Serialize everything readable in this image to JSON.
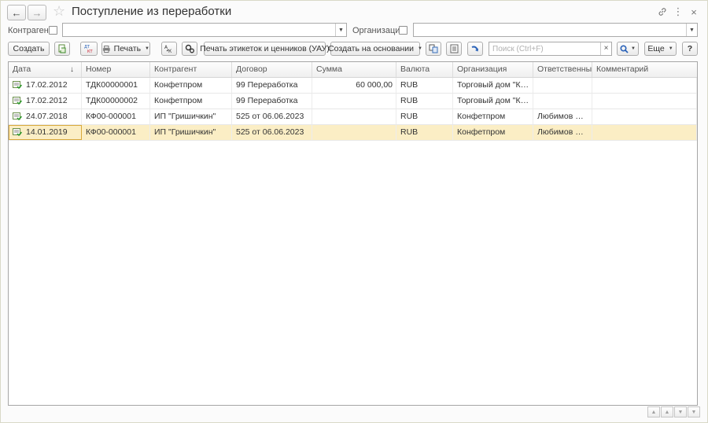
{
  "window": {
    "title": "Поступление из переработки",
    "back_icon": "arrow-left-icon",
    "forward_icon": "arrow-right-icon",
    "favorite_icon": "star-icon",
    "link_icon": "link-icon",
    "more_icon": "more-vert-icon",
    "close_icon": "close-icon"
  },
  "filters": {
    "counterparty_label": "Контрагент:",
    "counterparty_value": "",
    "organization_label": "Организация:",
    "organization_value": ""
  },
  "toolbar": {
    "create_label": "Создать",
    "print_label": "Печать",
    "print_labels_label": "Печать этикеток и ценников (УАУ)",
    "create_based_label": "Создать на основании",
    "search_placeholder": "Поиск (Ctrl+F)",
    "search_clear": "×",
    "more_label": "Еще",
    "help_label": "?",
    "dtkt_label": "ДТ/КТ"
  },
  "table": {
    "columns": [
      "Дата",
      "Номер",
      "Контрагент",
      "Договор",
      "Сумма",
      "Валюта",
      "Организация",
      "Ответственный",
      "Комментарий"
    ],
    "sort_indicator": "↓",
    "rows": [
      {
        "date": "17.02.2012",
        "number": "ТДК00000001",
        "counterparty": "Конфетпром",
        "contract": "99 Переработка",
        "sum": "60 000,00",
        "currency": "RUB",
        "organization": "Торговый дом \"Ком...",
        "responsible": "",
        "comment": ""
      },
      {
        "date": "17.02.2012",
        "number": "ТДК00000002",
        "counterparty": "Конфетпром",
        "contract": "99 Переработка",
        "sum": "",
        "currency": "RUB",
        "organization": "Торговый дом \"Ком...",
        "responsible": "",
        "comment": ""
      },
      {
        "date": "24.07.2018",
        "number": "КФ00-000001",
        "counterparty": "ИП \"Гришичкин\"",
        "contract": "525 от 06.06.2023",
        "sum": "",
        "currency": "RUB",
        "organization": "Конфетпром",
        "responsible": "Любимов Ва...",
        "comment": ""
      },
      {
        "date": "14.01.2019",
        "number": "КФ00-000001",
        "counterparty": "ИП \"Гришичкин\"",
        "contract": "525 от 06.06.2023",
        "sum": "",
        "currency": "RUB",
        "organization": "Конфетпром",
        "responsible": "Любимов Ва...",
        "comment": ""
      }
    ],
    "selected_row": 3
  },
  "colors": {
    "selected_row": "#fbeec5",
    "current_cell_border": "#d9a93b"
  }
}
